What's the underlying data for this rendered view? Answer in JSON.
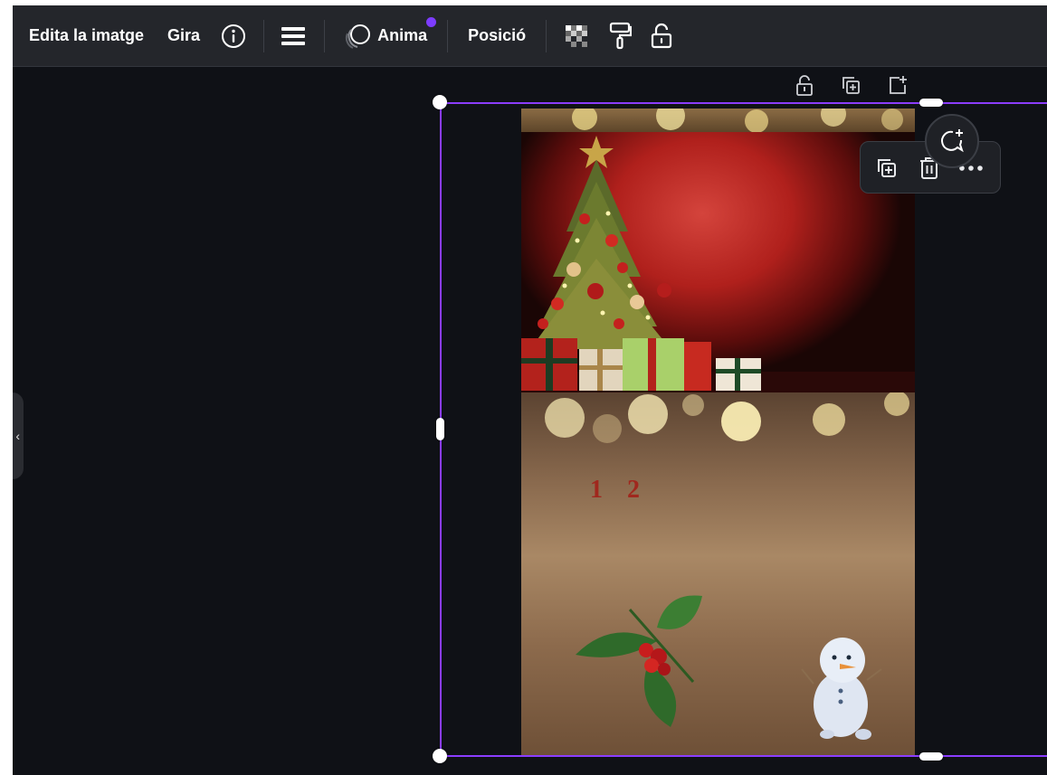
{
  "toolbar": {
    "edit_image": "Edita la imatge",
    "rotate": "Gira",
    "animate": "Anima",
    "position": "Posició",
    "icons": [
      "info-icon",
      "menu-icon",
      "animate-icon",
      "transparency-icon",
      "paint-format-icon",
      "lock-icon"
    ]
  },
  "page_actions": {
    "icons": [
      "lock-icon",
      "duplicate-page-icon",
      "add-page-icon"
    ]
  },
  "element_toolbar": {
    "icons": [
      "copy-element-icon",
      "delete-icon",
      "more-options-icon",
      "add-comment-icon"
    ]
  },
  "design": {
    "day_number": "1 2"
  },
  "colors": {
    "selection": "#8b3dff",
    "toolbar_bg": "#24262b",
    "canvas_bg": "#0f1116",
    "accent_dot": "#7d3cff"
  }
}
